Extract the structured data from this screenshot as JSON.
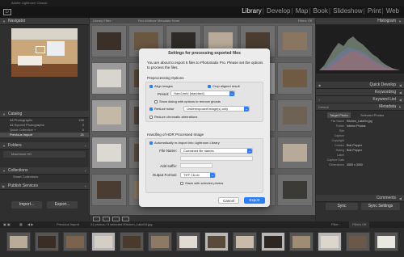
{
  "window_title": "Adobe Lightroom Classic",
  "modules": [
    "Library",
    "Develop",
    "Map",
    "Book",
    "Slideshow",
    "Print",
    "Web"
  ],
  "active_module": "Library",
  "left_panel": {
    "navigator": "Navigator",
    "catalog": "Catalog",
    "catalog_items": [
      {
        "label": "All Photographs",
        "count": "156"
      },
      {
        "label": "All Synced Photographs",
        "count": "0"
      },
      {
        "label": "Quick Collection +",
        "count": "0"
      },
      {
        "label": "Previous Import",
        "count": "21"
      }
    ],
    "folders": "Folders",
    "folder_item": "Macintosh HD",
    "collections": "Collections",
    "collection_item": "Smart Collections",
    "publish": "Publish Services",
    "import_btn": "Import...",
    "export_btn": "Export..."
  },
  "center": {
    "filter_label": "Library Filter :",
    "filter_tabs": "Text  Attribute  Metadata  None",
    "filter_off": "Filters Off"
  },
  "right_panel": {
    "histogram": "Histogram",
    "quick_develop": "Quick Develop",
    "keywording": "Keywording",
    "keyword_list": "Keyword List",
    "metadata": "Metadata",
    "preset_label": "Default",
    "target_photo": "Target Photo",
    "selected_photos": "Selected Photos",
    "meta": [
      {
        "k": "File Name",
        "v": "Kitchen_Lake04.jpg"
      },
      {
        "k": "Folder",
        "v": "Interior Photos"
      },
      {
        "k": "Title",
        "v": ""
      },
      {
        "k": "Caption",
        "v": ""
      },
      {
        "k": "Copyright",
        "v": ""
      },
      {
        "k": "Creator",
        "v": "Bob Pepper"
      },
      {
        "k": "Rating",
        "v": "Bob Pepper"
      },
      {
        "k": "Label",
        "v": ""
      },
      {
        "k": "Capture Date",
        "v": ""
      },
      {
        "k": "Dimensions",
        "v": "4500 x 3000"
      }
    ],
    "sync_btn": "Sync",
    "sync_settings_btn": "Sync Settings",
    "comments": "Comments"
  },
  "filmstrip_bar": {
    "label": "Previous Import",
    "info": "21 photos / 5 selected /Kitchen_Lake04.jpg",
    "filter": "Filter :",
    "filters_off": "Filters Off"
  },
  "dialog": {
    "title": "Settings for processing exported files",
    "intro": "You are about to export 5 files to Photomatix Pro.  Please set the options to process the files.",
    "processing_title": "Preprocessing Options",
    "align": "Align images",
    "crop": "Crop aligned result",
    "preset_label": "Preset:",
    "preset_value": "Hand-held (standard)",
    "show_ghost": "Show dialog with options to remove ghosts",
    "reduce_noise": "Reduce noise",
    "noise_value": "Underexposed image(s) only",
    "reduce_ca": "Reduce chromatic aberrations",
    "hdr_title": "Handling of HDR Processed Image",
    "reimport": "Automatically re-import into Lightroom Library",
    "file_name_label": "File Name:",
    "file_name_value": "Combined file names",
    "add_suffix_label": "Add suffix:",
    "output_label": "Output Format:",
    "output_value": "TIFF 16-bit",
    "stack": "Stack with selected photos",
    "cancel": "Cancel",
    "export": "Export"
  }
}
